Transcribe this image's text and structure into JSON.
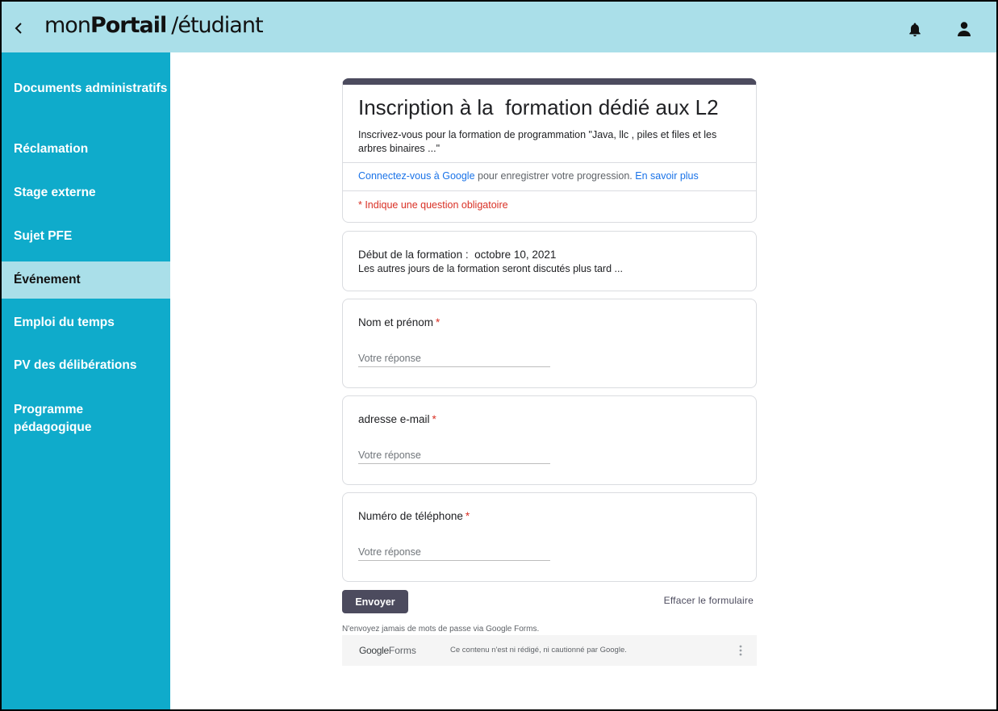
{
  "header": {
    "brand_mon": "mon",
    "brand_portail": "Portail",
    "brand_suffix": "/étudiant",
    "back_icon": "chevron-left-icon",
    "bell_icon": "bell-icon",
    "user_icon": "user-icon",
    "bg_color": "#aadfe9"
  },
  "sidebar": {
    "bg_color": "#0fabcb",
    "active_color": "#aadfe9",
    "items": [
      {
        "label": "Documents administratifs"
      },
      {
        "label": "Réclamation"
      },
      {
        "label": "Stage externe"
      },
      {
        "label": "Sujet PFE"
      },
      {
        "label": "Événement",
        "active": true
      },
      {
        "label": "Emploi du temps"
      },
      {
        "label": "PV des délibérations"
      },
      {
        "label": "Programme pédagogique"
      }
    ]
  },
  "form": {
    "accent_color": "#4c4b5e",
    "title": "Inscription à la  formation dédié aux L2",
    "description": "Inscrivez-vous pour la formation de programmation \"Java, llc , piles et files et les arbres binaires ...\"",
    "signin_link": "Connectez-vous à Google",
    "signin_text": " pour enregistrer votre progression. ",
    "learn_more": "En savoir plus",
    "required_note": "* Indique une question obligatoire",
    "info_line1": "Début de la formation :  octobre 10, 2021",
    "info_line2": "Les autres jours de la formation seront discutés plus tard ...",
    "questions": [
      {
        "label": "Nom et prénom",
        "required": "*",
        "placeholder": "Votre réponse",
        "value": ""
      },
      {
        "label": "adresse e-mail",
        "required": "*",
        "placeholder": "Votre réponse",
        "value": ""
      },
      {
        "label": "Numéro de téléphone",
        "required": "*",
        "placeholder": "Votre réponse",
        "value": ""
      }
    ],
    "submit_label": "Envoyer",
    "clear_label": "Effacer le formulaire",
    "password_warning": "N'envoyez jamais de mots de passe via Google Forms.",
    "footer_google": "Google",
    "footer_forms": "Forms",
    "footer_disclaimer": "Ce contenu n'est ni rédigé, ni cautionné par Google.",
    "more_icon": "more-vert-icon"
  }
}
